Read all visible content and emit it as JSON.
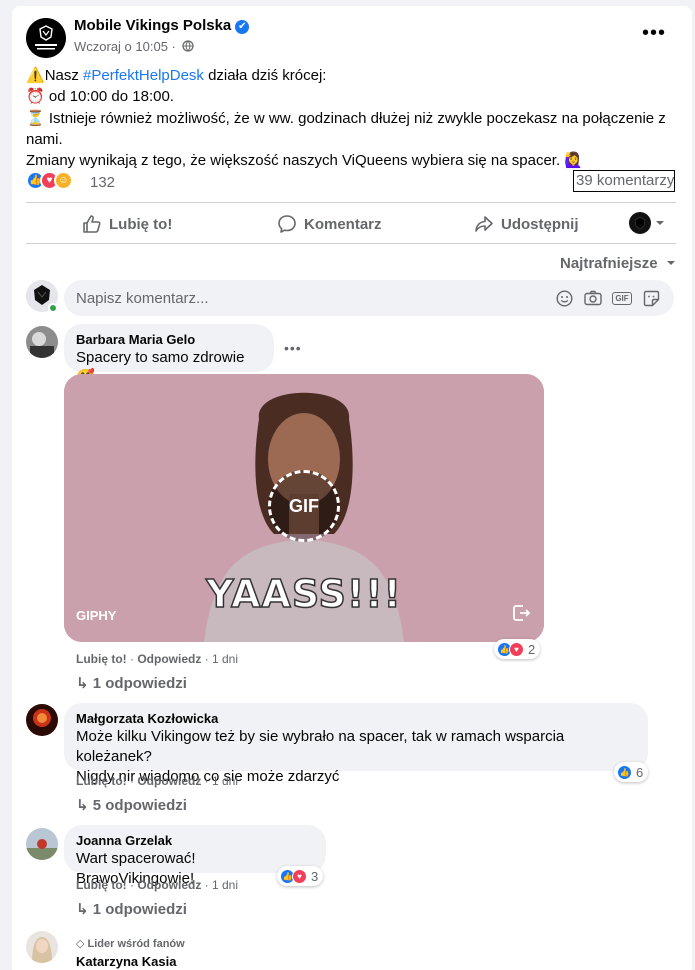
{
  "post": {
    "page_name": "Mobile Vikings Polska",
    "verified_mark": "✔",
    "meta_time": "Wczoraj o 10:05 ·",
    "body_line1_prefix": "Nasz ",
    "hashtag": "#PerfektHelpDesk",
    "body_line1_suffix": " działa dziś krócej:",
    "body_line2": " od 10:00 do 18:00.",
    "body_line3": " Istnieje również możliwość, że w ww. godzinach dłużej niż zwykle poczekasz na połączenie z nami.",
    "body_line4": "Zmiany wynikają z tego, że większość naszych ViQueens wybiera się na spacer. ",
    "reaction_count": "132",
    "comment_count": "39 komentarzy",
    "more_label": "•••",
    "icons": {
      "warning": "warning-icon",
      "alarm": "alarm-clock-icon",
      "hourglass": "hourglass-icon",
      "woman": "woman-raising-hand-icon"
    }
  },
  "actions": {
    "like": "Lubię to!",
    "comment": "Komentarz",
    "share": "Udostępnij"
  },
  "sort_label": "Najtrafniejsze",
  "composer": {
    "placeholder": "Napisz komentarz...",
    "gif_label": "GIF"
  },
  "comments": [
    {
      "name": "Barbara Maria Gelo",
      "text": "Spacery to samo zdrowie ",
      "like": "Lubię to!",
      "reply": "Odpowiedz",
      "time": "1 dni",
      "reactions": "2",
      "replies": "1 odpowiedzi",
      "gif": {
        "caption": "YAASS!!!",
        "badge": "GIF",
        "source": "GIPHY"
      }
    },
    {
      "name": "Małgorzata Kozłowicka",
      "text_line1": "Może kilku Vikingow też by sie wybrało na spacer, tak w ramach wsparcia koleżanek?",
      "text_line2": "Nigdy nir wiadomo co sie może zdarzyć",
      "like": "Lubię to!",
      "reply": "Odpowiedz",
      "time": "1 dni",
      "reactions": "6",
      "replies": "5 odpowiedzi"
    },
    {
      "name": "Joanna Grzelak",
      "text": "Wart spacerować! BrawoVikingowie!",
      "like": "Lubię to!",
      "reply": "Odpowiedz",
      "time": "1 dni",
      "reactions": "3",
      "replies": "1 odpowiedzi"
    },
    {
      "badge": "Lider wśród fanów",
      "name": "Katarzyna Kasia"
    }
  ],
  "colors": {
    "brand_blue": "#1877f2",
    "secondary_text": "#65676b",
    "love_red": "#f33e58",
    "online_green": "#31a24c"
  }
}
